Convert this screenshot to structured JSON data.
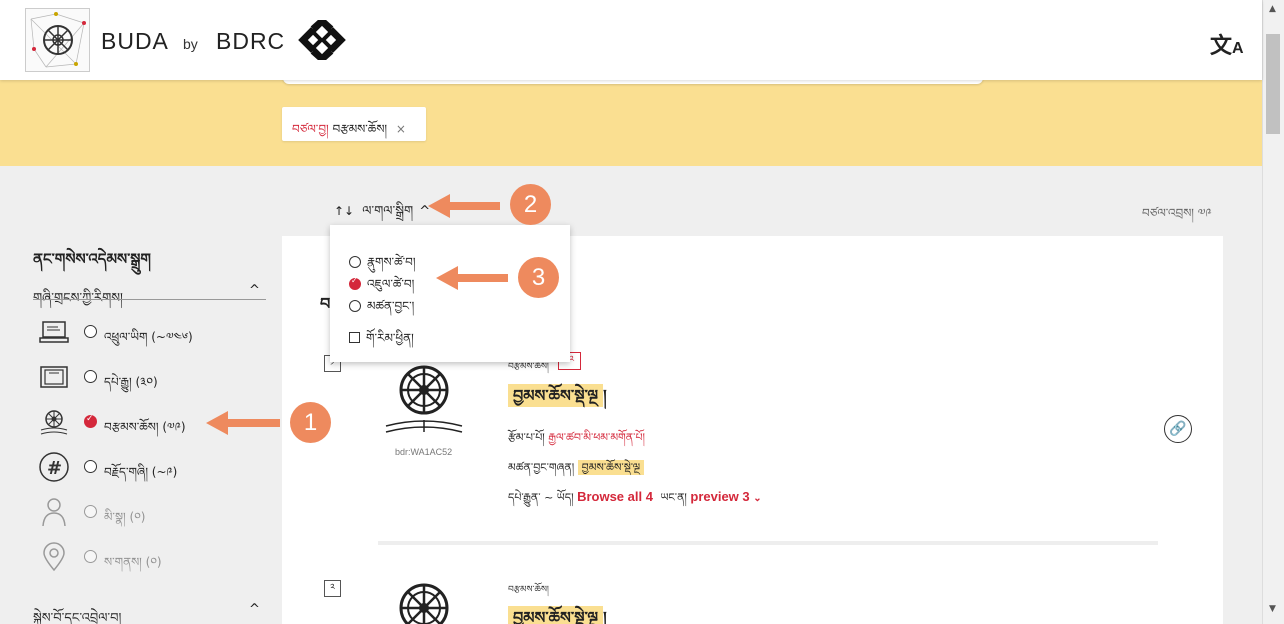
{
  "header": {
    "brand": "BUDA",
    "by": "by",
    "org": "BDRC",
    "translate_icon": "translate-icon"
  },
  "query_chip": {
    "prefix": "བཙལ་བྱ།",
    "value": "བརྩམས་ཆོས།",
    "close": "×"
  },
  "sort": {
    "icon": "↑↓",
    "label": "ལ་གལ་སྒྲིག",
    "chevron": "^"
  },
  "results_count": "བཙལ་འབྲས། ༧༩",
  "sort_dropdown": {
    "options": [
      {
        "label": "རྣུགས་ཚེ་བ།",
        "checked": false
      },
      {
        "label": "འཇུལ་ཚེ་བ།",
        "checked": true
      },
      {
        "label": "མཚན་བྱང་།",
        "checked": false
      }
    ],
    "reverse_label": "གོ་རིམ་ཕྱིན།"
  },
  "sidebar": {
    "title": "ནང་གསེས་འདེམས་སྒྲུག",
    "section_title": "གཞི་གྲངས་ཀྱི་རིགས།",
    "items": [
      {
        "label": "འཕྲུལ་ཡིག  (~༧༤༦)",
        "checked": false,
        "icon": "laptop-icon"
      },
      {
        "label": "དཔེ་རྒྱུ།  (༣༠)",
        "checked": false,
        "icon": "book-pecha-icon"
      },
      {
        "label": "བརྩམས་ཆོས།  (༧༩)",
        "checked": true,
        "icon": "dharma-wheel-icon"
      },
      {
        "label": "བརྗོད་གཞི།  (~༩)",
        "checked": false,
        "icon": "hash-icon"
      },
      {
        "label": "མི་སྣ།  (༠)",
        "checked": false,
        "icon": "person-icon"
      },
      {
        "label": "ས་གནས།  (༠)",
        "checked": false,
        "icon": "location-pin-icon"
      }
    ],
    "section2_title": "སྐྱེས་བོ་དང་འབྲེལ་བ།"
  },
  "results": {
    "letter": "བ",
    "items": [
      {
        "num": "༡",
        "id": "bdr:WA1AC52",
        "type_small": "བརྩམས་ཆོས།",
        "tag": "༡༢",
        "title": "བྱམས་ཆོས་སྡེ་ལྔ",
        "title_suffix": "།",
        "author_label": "རྩོམ་པ་པོ།",
        "author_value": "རྒྱལ་ཚབ་མི་ཕམ་མགོན་པོ།",
        "match_label": "མཚན་བྱང་གཞན།",
        "match_value": "བྱམས་ཆོས་སྡེ་ལྔ",
        "editions_label": "དཔེ་རྒྱུན་ ~ ཡོད།",
        "browse": "Browse all 4",
        "preview_label": "ཡང་ན།",
        "preview": "preview 3"
      },
      {
        "num": "༢",
        "type_small": "བརྩམས་ཆོས།",
        "title": "བྱམས་ཆོས་སྡེ་ལྔ",
        "title_suffix": "།"
      }
    ]
  },
  "annotations": [
    "1",
    "2",
    "3"
  ],
  "colors": {
    "accent_red": "#d4283b",
    "highlight": "#fadf91",
    "annotation": "#ee8a5e"
  }
}
